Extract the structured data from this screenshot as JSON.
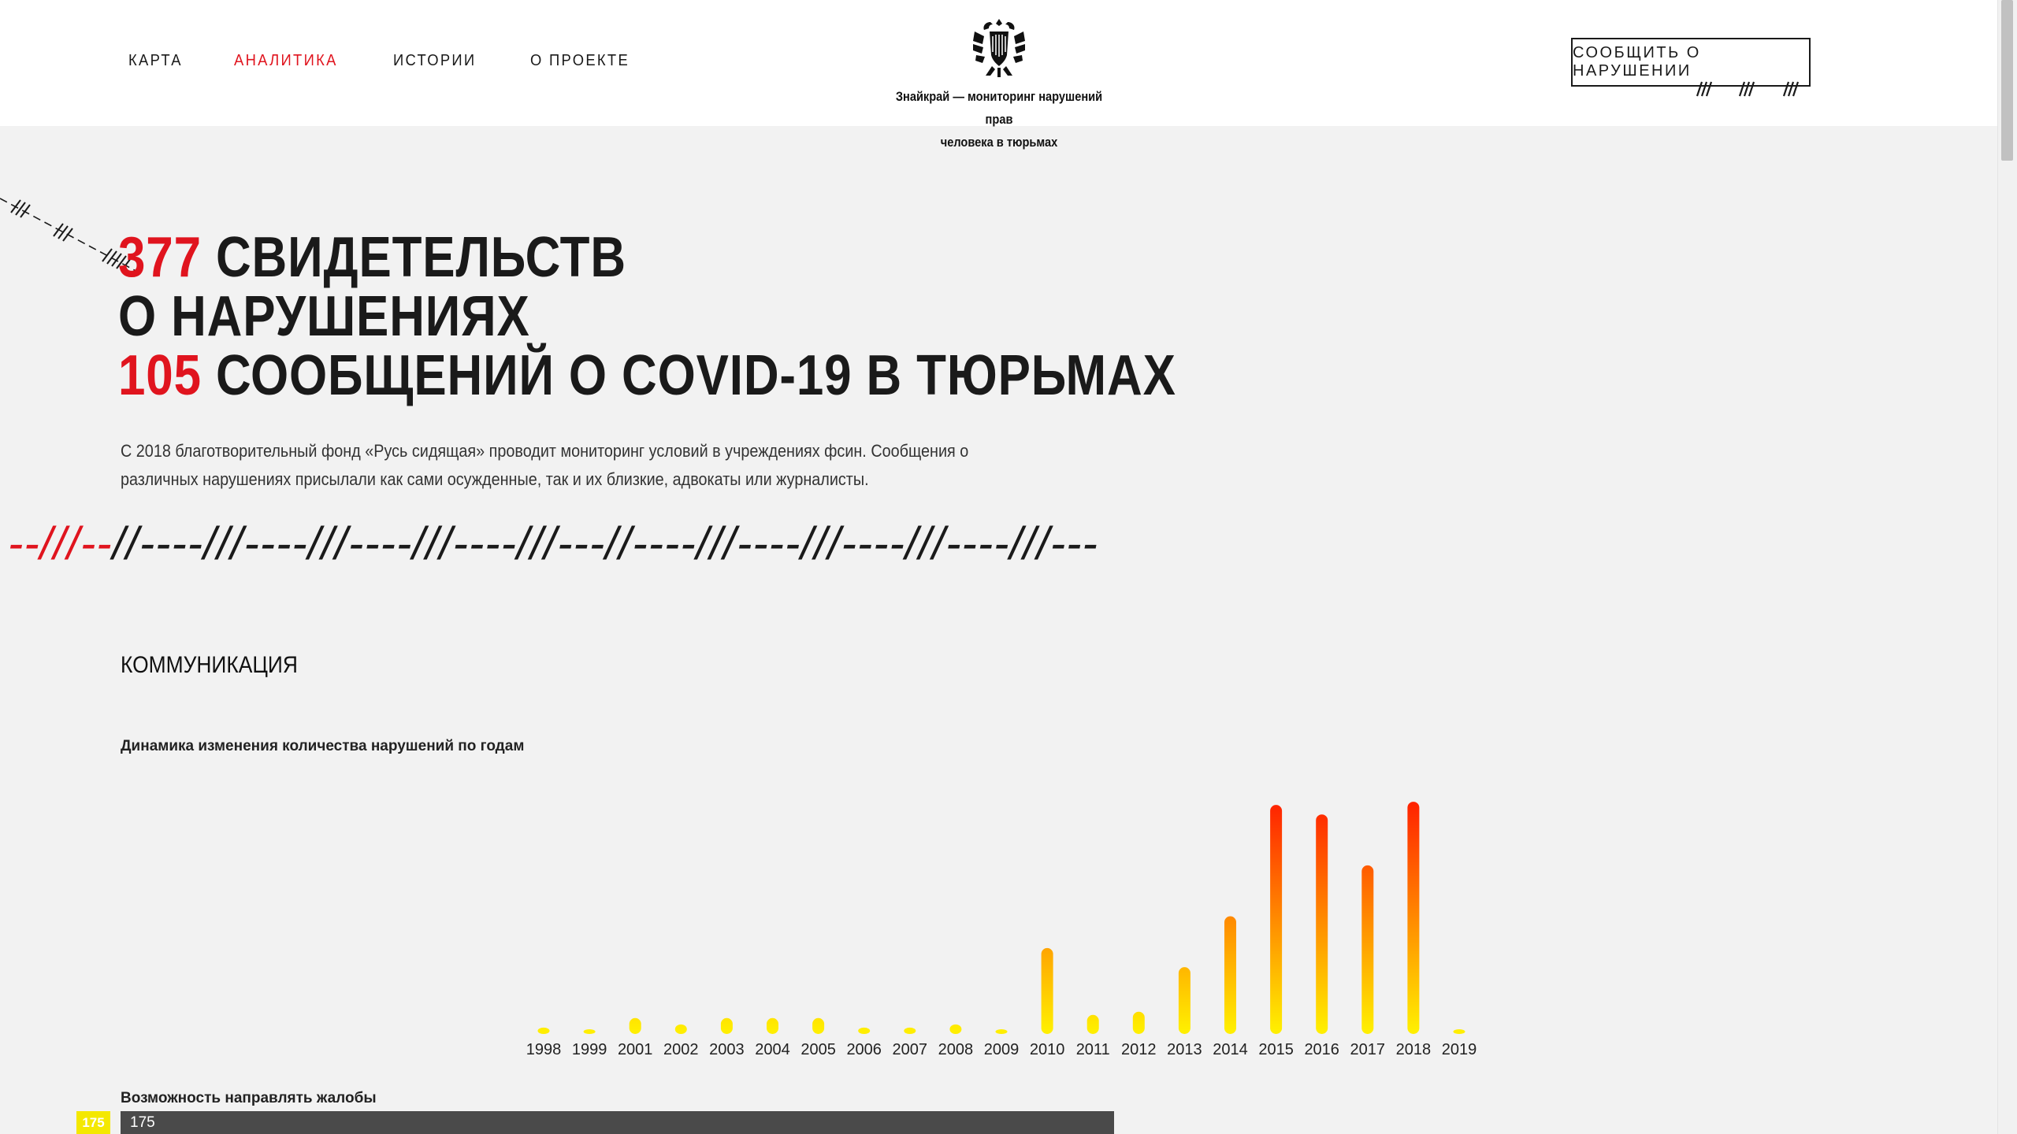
{
  "nav": {
    "items": [
      {
        "label": "КАРТА"
      },
      {
        "label": "АНАЛИТИКА"
      },
      {
        "label": "ИСТОРИИ"
      },
      {
        "label": "О ПРОЕКТЕ"
      }
    ],
    "active_item": "АНАЛИТИКА"
  },
  "logo": {
    "icon": "double-headed-eagle-icon",
    "line1": "Знайкрай — мониторинг нарушений прав",
    "line2": "человека в тюрьмах"
  },
  "report_button": {
    "label": "СООБЩИТЬ О НАРУШЕНИИ"
  },
  "hero": {
    "count1": "377",
    "text1a": "СВИДЕТЕЛЬСТВ",
    "text1b": "О НАРУШЕНИЯХ",
    "count2": "105",
    "text2": "СООБЩЕНИЙ О COVID-19 В ТЮРЬМАХ"
  },
  "intro": {
    "text": "С 2018 благотворительный фонд «Русь сидящая» проводит мониторинг условий в учреждениях фсин. Сообщения о различных нарушениях присылали как сами осужденные, так и их близкие, адвокаты или журналисты."
  },
  "divider": {
    "red_part": "--///--",
    "black_part": "//----///----///----///----///---//----///----///----///----///---"
  },
  "section": {
    "title": "КОММУНИКАЦИЯ"
  },
  "chart_title": "Динамика изменения количества нарушений по годам",
  "chart_data": {
    "type": "bar",
    "title": "Динамика изменения количества нарушений по годам",
    "xlabel": "",
    "ylabel": "",
    "categories": [
      "1998",
      "1999",
      "2001",
      "2002",
      "2003",
      "2004",
      "2005",
      "2006",
      "2007",
      "2008",
      "2009",
      "2010",
      "2011",
      "2012",
      "2013",
      "2014",
      "2015",
      "2016",
      "2017",
      "2018",
      "2019"
    ],
    "values": [
      2,
      1,
      5,
      3,
      5,
      5,
      5,
      2,
      2,
      3,
      1,
      27,
      6,
      7,
      21,
      37,
      72,
      69,
      53,
      73,
      0.5
    ],
    "ylim": [
      0,
      75
    ],
    "grid": false,
    "legend": "none",
    "colors": {
      "low": "#ffee00",
      "high": "#ff1a00"
    }
  },
  "bar2": {
    "title": "Возможность направлять жалобы",
    "badge_value": "175",
    "bar_value": "175"
  },
  "colors": {
    "accent": "#e0141e",
    "text": "#1a1a1a",
    "background": "#f2f2f2",
    "header": "#ffffff",
    "bar_dark": "#4a4a4a",
    "badge": "#f4e800"
  }
}
